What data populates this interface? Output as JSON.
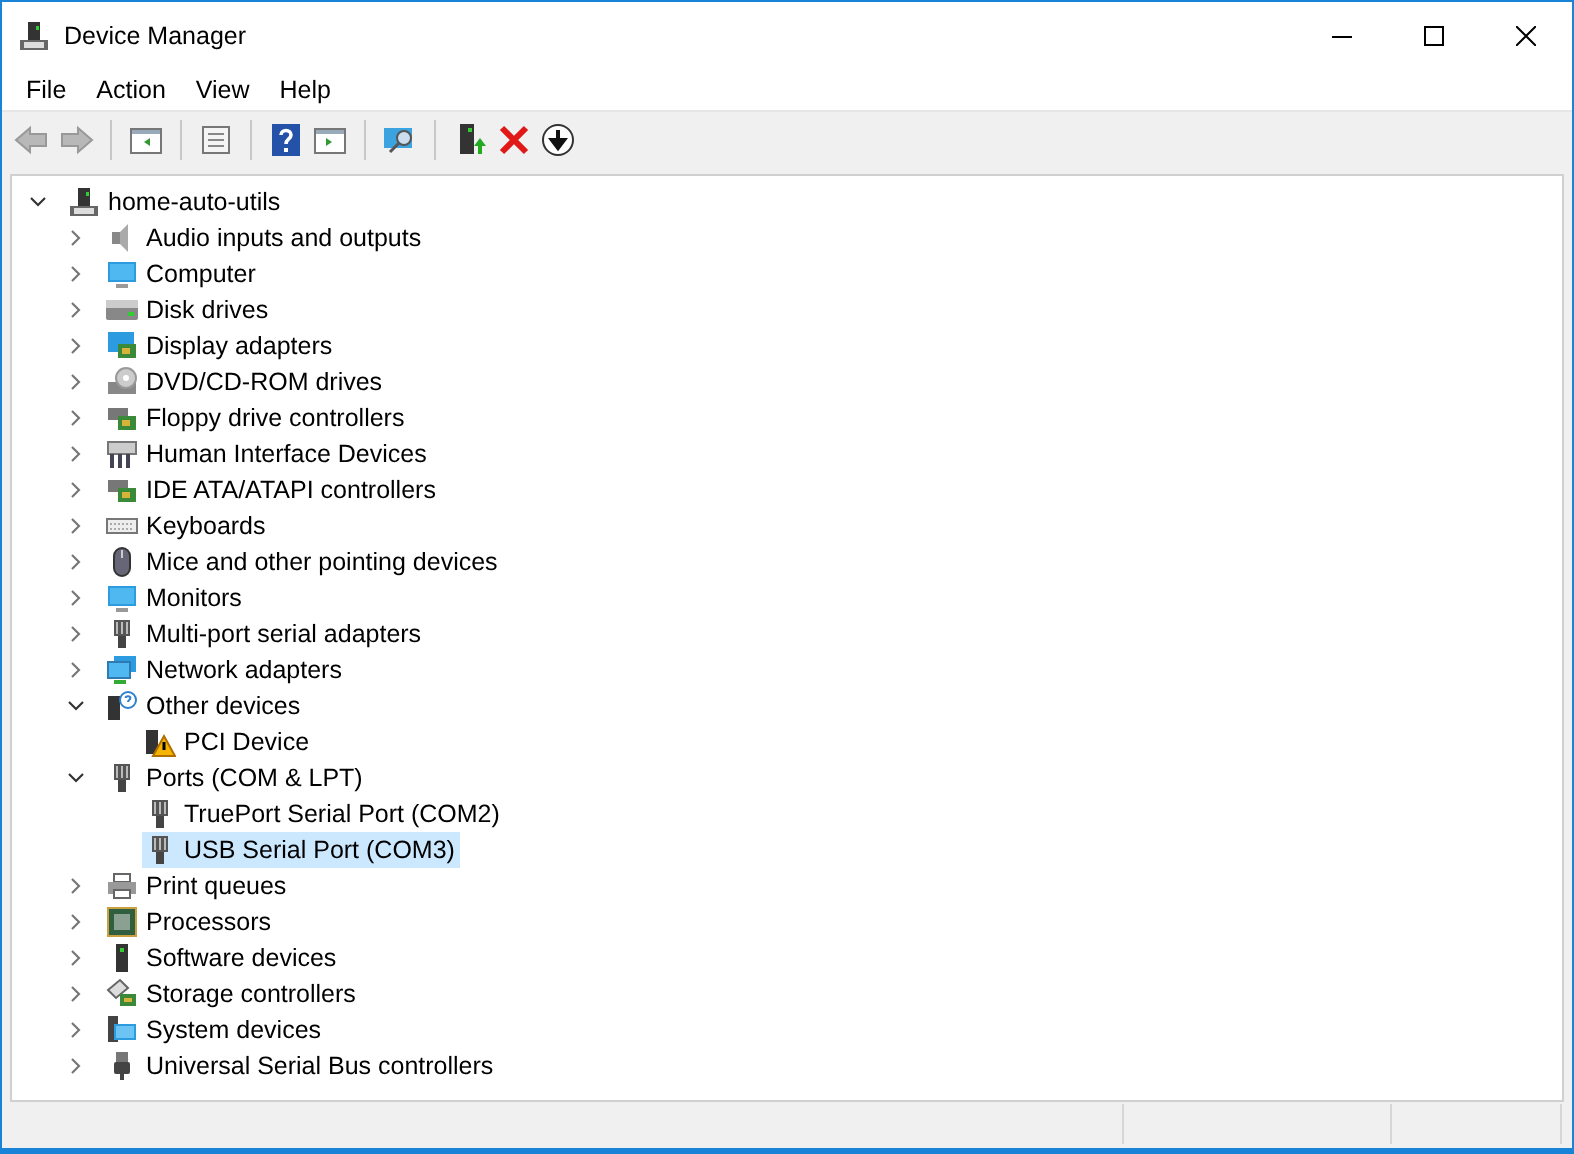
{
  "window": {
    "title": "Device Manager"
  },
  "menu": [
    "File",
    "Action",
    "View",
    "Help"
  ],
  "tree": [
    {
      "label": "home-auto-utils",
      "kind": "computer",
      "expanded": true,
      "selected": false,
      "children": [
        {
          "label": "Audio inputs and outputs",
          "kind": "audio",
          "expanded": false,
          "selected": false
        },
        {
          "label": "Computer",
          "kind": "monitor",
          "expanded": false,
          "selected": false
        },
        {
          "label": "Disk drives",
          "kind": "disk",
          "expanded": false,
          "selected": false
        },
        {
          "label": "Display adapters",
          "kind": "display",
          "expanded": false,
          "selected": false
        },
        {
          "label": "DVD/CD-ROM drives",
          "kind": "dvd",
          "expanded": false,
          "selected": false
        },
        {
          "label": "Floppy drive controllers",
          "kind": "floppy",
          "expanded": false,
          "selected": false
        },
        {
          "label": "Human Interface Devices",
          "kind": "hid",
          "expanded": false,
          "selected": false
        },
        {
          "label": "IDE ATA/ATAPI controllers",
          "kind": "ide",
          "expanded": false,
          "selected": false
        },
        {
          "label": "Keyboards",
          "kind": "keyboard",
          "expanded": false,
          "selected": false
        },
        {
          "label": "Mice and other pointing devices",
          "kind": "mouse",
          "expanded": false,
          "selected": false
        },
        {
          "label": "Monitors",
          "kind": "monitor",
          "expanded": false,
          "selected": false
        },
        {
          "label": "Multi-port serial adapters",
          "kind": "port",
          "expanded": false,
          "selected": false
        },
        {
          "label": "Network adapters",
          "kind": "network",
          "expanded": false,
          "selected": false
        },
        {
          "label": "Other devices",
          "kind": "unknown",
          "expanded": true,
          "selected": false,
          "children": [
            {
              "label": "PCI Device",
              "kind": "warning",
              "selected": false
            }
          ]
        },
        {
          "label": "Ports (COM & LPT)",
          "kind": "port",
          "expanded": true,
          "selected": false,
          "children": [
            {
              "label": "TruePort Serial Port (COM2)",
              "kind": "port",
              "selected": false
            },
            {
              "label": "USB Serial Port (COM3)",
              "kind": "port",
              "selected": true
            }
          ]
        },
        {
          "label": "Print queues",
          "kind": "printer",
          "expanded": false,
          "selected": false
        },
        {
          "label": "Processors",
          "kind": "processor",
          "expanded": false,
          "selected": false
        },
        {
          "label": "Software devices",
          "kind": "software",
          "expanded": false,
          "selected": false
        },
        {
          "label": "Storage controllers",
          "kind": "storage",
          "expanded": false,
          "selected": false
        },
        {
          "label": "System devices",
          "kind": "system",
          "expanded": false,
          "selected": false
        },
        {
          "label": "Universal Serial Bus controllers",
          "kind": "usb",
          "expanded": false,
          "selected": false
        }
      ]
    }
  ]
}
